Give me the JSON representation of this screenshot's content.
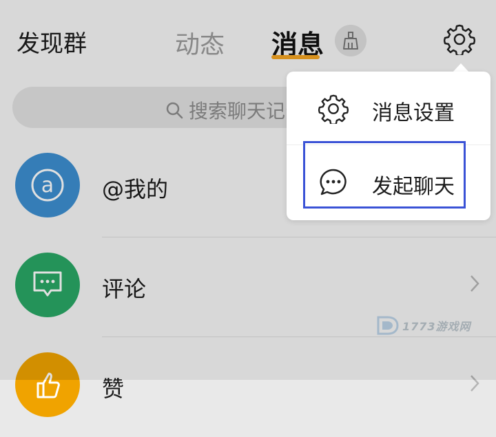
{
  "header": {
    "left_label": "发现群",
    "tab_dynamic": "动态",
    "tab_messages": "消息",
    "clean_icon": "broom-icon",
    "settings_icon": "gear-icon",
    "accent_color": "#f5a623"
  },
  "search": {
    "placeholder": "搜索聊天记录",
    "icon": "search-icon"
  },
  "list": [
    {
      "title": "@我的",
      "icon": "at-icon",
      "color": "#3d8fd1"
    },
    {
      "title": "评论",
      "icon": "chat-bubble-dots-icon",
      "color": "#2aa866"
    },
    {
      "title": "赞",
      "icon": "thumb-up-icon",
      "color": "#f0a300"
    }
  ],
  "popup": {
    "items": [
      {
        "label": "消息设置",
        "icon": "gear-icon"
      },
      {
        "label": "发起聊天",
        "icon": "chat-bubble-icon"
      }
    ],
    "highlight_color": "#3a52d6"
  },
  "watermark": {
    "text": "1773游戏网"
  }
}
